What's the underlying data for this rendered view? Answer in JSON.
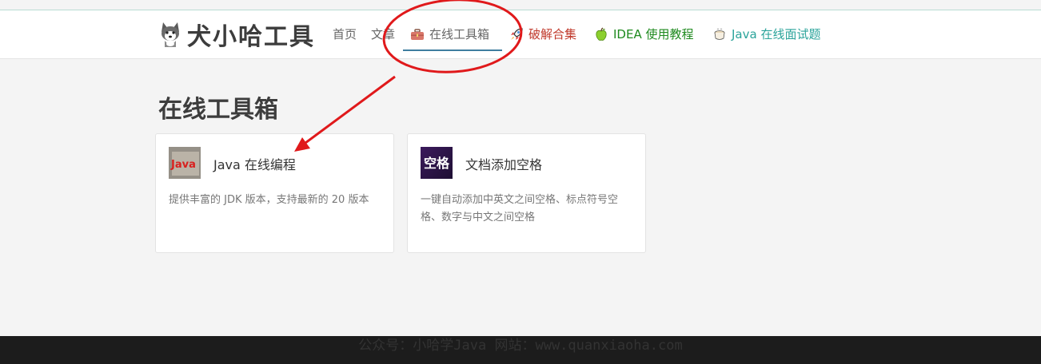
{
  "brand": {
    "name": "犬小哈工具",
    "icon": "husky-dog-icon"
  },
  "nav": {
    "items": [
      {
        "label": "首页"
      },
      {
        "label": "文章"
      },
      {
        "label": "在线工具箱",
        "icon": "toolbox-icon",
        "active": true
      },
      {
        "label": "破解合集",
        "icon": "rocket-icon",
        "color": "#c0392b"
      },
      {
        "label": "IDEA 使用教程",
        "icon": "green-apple-icon",
        "color": "#1e8a1e"
      },
      {
        "label": "Java 在线面试题",
        "icon": "coffee-cup-icon",
        "color": "#2aa39a"
      }
    ],
    "active_color": "#3f7e9f"
  },
  "main": {
    "title": "在线工具箱",
    "cards": [
      {
        "thumb_text": "Java",
        "name": "Java 在线编程",
        "desc": "提供丰富的 JDK 版本，支持最新的 20 版本"
      },
      {
        "thumb_text": "空格",
        "name": "文档添加空格",
        "desc": "一键自动添加中英文之间空格、标点符号空格、数字与中文之间空格"
      }
    ]
  },
  "footer": {
    "watermark": "公众号：小哈学Java 网站：www.quanxiaoha.com"
  },
  "annotation": {
    "color": "#e0191b"
  }
}
